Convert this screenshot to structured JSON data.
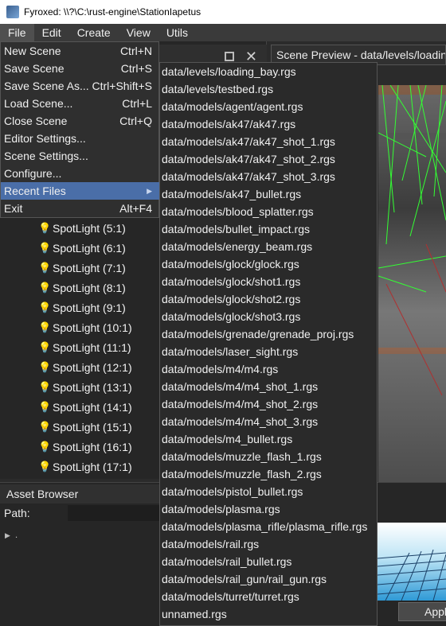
{
  "window": {
    "title": "Fyroxed: \\\\?\\C:\\rust-engine\\StationIapetus"
  },
  "menubar": {
    "items": [
      "File",
      "Edit",
      "Create",
      "View",
      "Utils"
    ]
  },
  "file_menu": {
    "items": [
      {
        "label": "New Scene",
        "shortcut": "Ctrl+N"
      },
      {
        "label": "Save Scene",
        "shortcut": "Ctrl+S"
      },
      {
        "label": "Save Scene As...",
        "shortcut": "Ctrl+Shift+S"
      },
      {
        "label": "Load Scene...",
        "shortcut": "Ctrl+L"
      },
      {
        "label": "Close Scene",
        "shortcut": "Ctrl+Q"
      },
      {
        "label": "Editor Settings...",
        "shortcut": ""
      },
      {
        "label": "Scene Settings...",
        "shortcut": ""
      },
      {
        "label": "Configure...",
        "shortcut": ""
      },
      {
        "label": "Recent Files",
        "shortcut": ""
      },
      {
        "label": "Exit",
        "shortcut": "Alt+F4"
      }
    ]
  },
  "recent_files": [
    "data/levels/loading_bay.rgs",
    "data/levels/testbed.rgs",
    "data/models/agent/agent.rgs",
    "data/models/ak47/ak47.rgs",
    "data/models/ak47/ak47_shot_1.rgs",
    "data/models/ak47/ak47_shot_2.rgs",
    "data/models/ak47/ak47_shot_3.rgs",
    "data/models/ak47_bullet.rgs",
    "data/models/blood_splatter.rgs",
    "data/models/bullet_impact.rgs",
    "data/models/energy_beam.rgs",
    "data/models/glock/glock.rgs",
    "data/models/glock/shot1.rgs",
    "data/models/glock/shot2.rgs",
    "data/models/glock/shot3.rgs",
    "data/models/grenade/grenade_proj.rgs",
    "data/models/laser_sight.rgs",
    "data/models/m4/m4.rgs",
    "data/models/m4/m4_shot_1.rgs",
    "data/models/m4/m4_shot_2.rgs",
    "data/models/m4/m4_shot_3.rgs",
    "data/models/m4_bullet.rgs",
    "data/models/muzzle_flash_1.rgs",
    "data/models/muzzle_flash_2.rgs",
    "data/models/pistol_bullet.rgs",
    "data/models/plasma.rgs",
    "data/models/plasma_rifle/plasma_rifle.rgs",
    "data/models/rail.rgs",
    "data/models/rail_bullet.rgs",
    "data/models/rail_gun/rail_gun.rgs",
    "data/models/turret/turret.rgs",
    "unnamed.rgs"
  ],
  "scene_tree": {
    "items": [
      "SpotLight (5:1)",
      "SpotLight (6:1)",
      "SpotLight (7:1)",
      "SpotLight (8:1)",
      "SpotLight (9:1)",
      "SpotLight (10:1)",
      "SpotLight (11:1)",
      "SpotLight (12:1)",
      "SpotLight (13:1)",
      "SpotLight (14:1)",
      "SpotLight (15:1)",
      "SpotLight (16:1)",
      "SpotLight (17:1)"
    ]
  },
  "scene_preview": {
    "title": "Scene Preview - data/levels/loading_bay.rgs"
  },
  "asset_browser": {
    "title": "Asset Browser",
    "path_label": "Path:",
    "root_label": ".",
    "apply_label": "Apply"
  },
  "colors": {
    "highlight": "#4a6ea8",
    "wireframe": "#33ff33"
  }
}
